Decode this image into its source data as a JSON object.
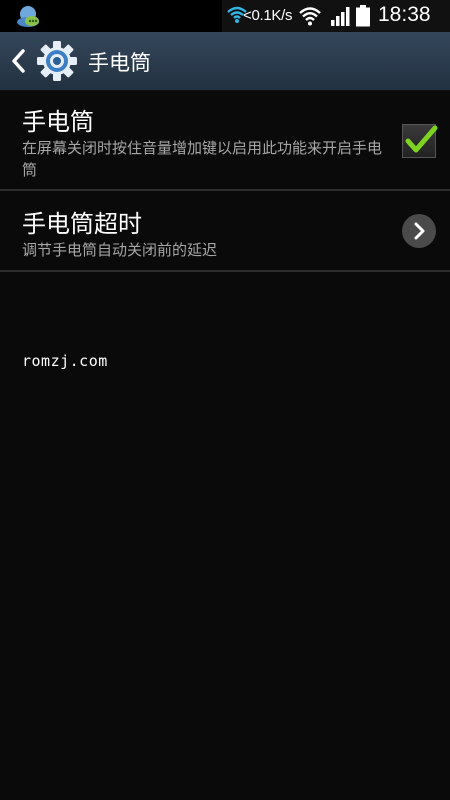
{
  "status_bar": {
    "net_speed": "<0.1K/s",
    "time": "18:38"
  },
  "action_bar": {
    "title": "手电筒"
  },
  "settings": {
    "items": [
      {
        "title": "手电筒",
        "summary": "在屏幕关闭时按住音量增加键以启用此功能来开启手电筒",
        "control": "checkbox",
        "checked": true
      },
      {
        "title": "手电筒超时",
        "summary": "调节手电筒自动关闭前的延迟",
        "control": "chevron"
      }
    ]
  },
  "watermark": "romzj.com",
  "colors": {
    "accent": "#7ed321",
    "action_bar": "#2b3a4a",
    "background": "#0a0a0a",
    "summary_text": "#a6a6a6"
  },
  "icons": {
    "app_notification": "chat-notification-icon",
    "back": "back-chevron-icon",
    "settings": "gear-icon",
    "checkbox": "checkmark-icon",
    "more": "chevron-right-icon"
  }
}
